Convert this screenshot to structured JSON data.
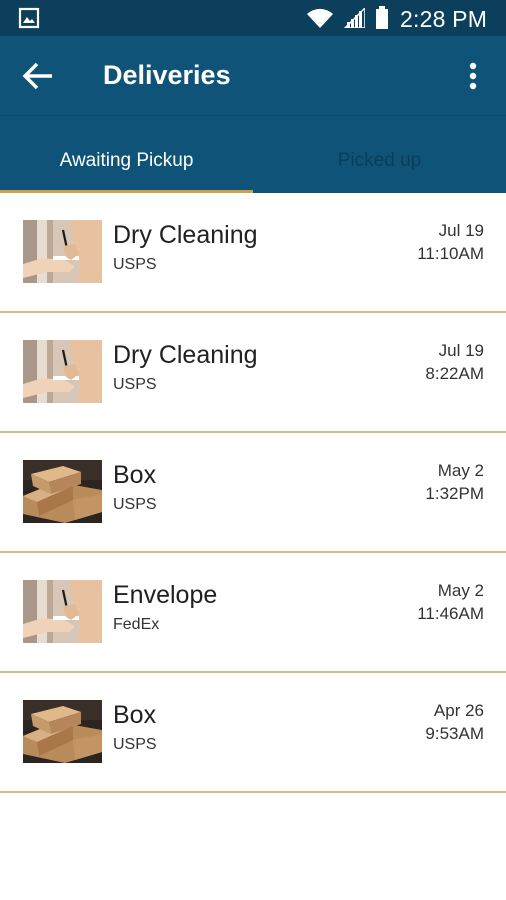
{
  "status_bar": {
    "time": "2:28 PM",
    "icons": [
      "gallery-icon",
      "wifi-icon",
      "signal-icon",
      "battery-icon"
    ]
  },
  "app_bar": {
    "title": "Deliveries",
    "back_icon": "arrow-left-icon",
    "menu_icon": "more-vertical-icon"
  },
  "tabs": [
    {
      "label": "Awaiting Pickup",
      "active": true
    },
    {
      "label": "Picked up",
      "active": false
    }
  ],
  "deliveries": [
    {
      "name": "Dry Cleaning",
      "carrier": "USPS",
      "date": "Jul 19",
      "time": "11:10AM",
      "thumbnail": "signing-receipt-photo"
    },
    {
      "name": "Dry Cleaning",
      "carrier": "USPS",
      "date": "Jul 19",
      "time": "8:22AM",
      "thumbnail": "signing-receipt-photo"
    },
    {
      "name": "Box",
      "carrier": "USPS",
      "date": "May 2",
      "time": "1:32PM",
      "thumbnail": "cardboard-boxes-photo"
    },
    {
      "name": "Envelope",
      "carrier": "FedEx",
      "date": "May 2",
      "time": "11:46AM",
      "thumbnail": "signing-receipt-photo"
    },
    {
      "name": "Box",
      "carrier": "USPS",
      "date": "Apr 26",
      "time": "9:53AM",
      "thumbnail": "cardboard-boxes-photo"
    }
  ],
  "colors": {
    "status_bar": "#0b3f5c",
    "app_bar": "#0f5478",
    "accent": "#c9a24a",
    "divider": "#d6bc86"
  }
}
